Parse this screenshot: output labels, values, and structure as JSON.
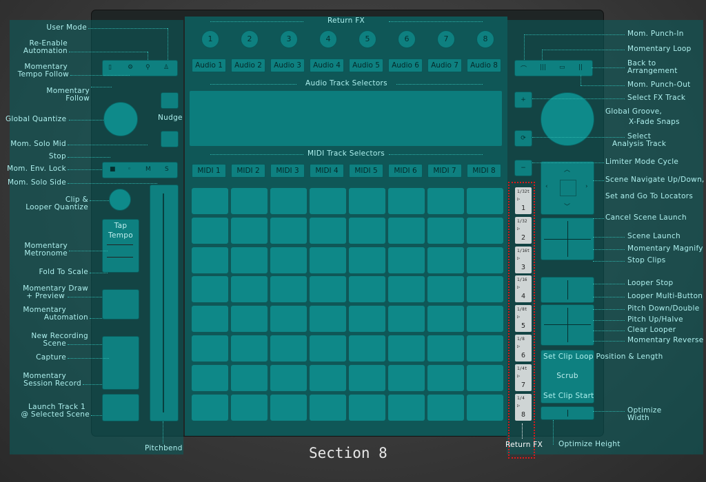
{
  "section": {
    "title": "Section 8"
  },
  "top": {
    "return_fx": "Return FX",
    "audio_selectors": "Audio Track Selectors",
    "midi_selectors": "MIDI Track Selectors",
    "return_fx_bottom": "Return FX"
  },
  "return_knobs": [
    "1",
    "2",
    "3",
    "4",
    "5",
    "6",
    "7",
    "8"
  ],
  "audio_tracks": [
    "Audio 1",
    "Audio 2",
    "Audio 3",
    "Audio 4",
    "Audio 5",
    "Audio 6",
    "Audio 7",
    "Audio 8"
  ],
  "midi_tracks": [
    "MIDI 1",
    "MIDI 2",
    "MIDI 3",
    "MIDI 4",
    "MIDI 5",
    "MIDI 6",
    "MIDI 7",
    "MIDI 8"
  ],
  "scene_buttons": [
    {
      "fraction": "1/32t",
      "num": "1"
    },
    {
      "fraction": "1/32",
      "num": "2"
    },
    {
      "fraction": "1/16t",
      "num": "3"
    },
    {
      "fraction": "1/16",
      "num": "4"
    },
    {
      "fraction": "1/8t",
      "num": "5"
    },
    {
      "fraction": "1/8",
      "num": "6"
    },
    {
      "fraction": "1/4t",
      "num": "7"
    },
    {
      "fraction": "1/4",
      "num": "8"
    }
  ],
  "device": {
    "nudge": "Nudge",
    "tap_tempo_1": "Tap",
    "tap_tempo_2": "Tempo",
    "scrub": "Scrub"
  },
  "left_labels": {
    "user_mode": "User Mode",
    "re_enable_1": "Re-Enable",
    "re_enable_2": "Automation",
    "mom_tempo_1": "Momentary",
    "mom_tempo_2": "Tempo Follow",
    "mom_follow_1": "Momentary",
    "mom_follow_2": "Follow",
    "global_quantize": "Global Quantize",
    "mom_solo_mid": "Mom. Solo Mid",
    "stop": "Stop",
    "mom_env_lock": "Mom. Env. Lock",
    "mom_solo_side": "Mom. Solo Side",
    "clip_looper_1": "Clip &",
    "clip_looper_2": "Looper Quantize",
    "mom_metronome_1": "Momentary",
    "mom_metronome_2": "Metronome",
    "fold_to_scale": "Fold To Scale",
    "mom_draw_1": "Momentary Draw",
    "mom_draw_2": "+ Preview",
    "mom_automation_1": "Momentary",
    "mom_automation_2": "Automation",
    "new_rec_1": "New Recording",
    "new_rec_2": "Scene",
    "capture": "Capture",
    "mom_session_1": "Momentary",
    "mom_session_2": "Session Record",
    "launch_track_1": "Launch Track 1",
    "launch_track_2": "@ Selected Scene",
    "pitchbend": "Pitchbend"
  },
  "right_labels": {
    "mom_punch_in": "Mom. Punch-In",
    "momentary_loop": "Momentary Loop",
    "back_arr_1": "Back to",
    "back_arr_2": "Arrangement",
    "mom_punch_out": "Mom. Punch-Out",
    "select_fx_track": "Select FX Track",
    "global_groove_1": "Global Groove,",
    "global_groove_2": "X-Fade Snaps",
    "select_analysis_1": "Select",
    "select_analysis_2": "Analysis Track",
    "limiter_mode": "Limiter Mode Cycle",
    "scene_nav_1": "Scene Navigate Up/Down,",
    "scene_nav_2": "Set and Go To Locators",
    "cancel_scene": "Cancel Scene Launch",
    "scene_launch": "Scene Launch",
    "mom_magnify": "Momentary Magnify",
    "stop_clips": "Stop Clips",
    "looper_stop": "Looper Stop",
    "looper_multi": "Looper Multi-Button",
    "pitch_down": "Pitch Down/Double",
    "pitch_up": "Pitch Up/Halve",
    "clear_looper": "Clear Looper",
    "mom_reverse": "Momentary Reverse",
    "set_clip_loop": "Set Clip Loop Position & Length",
    "set_clip_start": "Set Clip Start",
    "optimize_width_1": "Optimize",
    "optimize_width_2": "Width",
    "optimize_height": "Optimize Height"
  }
}
